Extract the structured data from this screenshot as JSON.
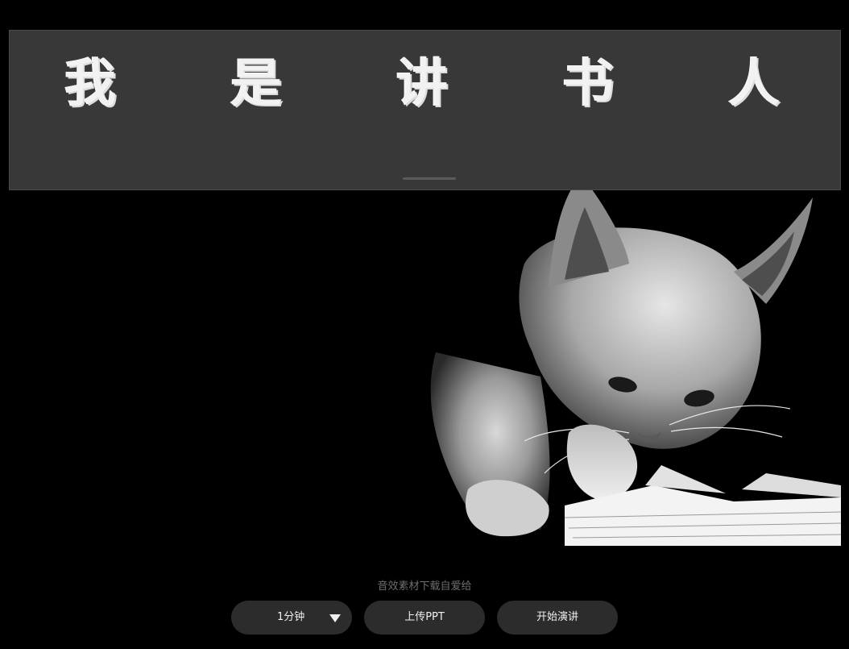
{
  "slide": {
    "title_chars": [
      "我",
      "是",
      "讲",
      "书",
      "人"
    ]
  },
  "credit_text": "音效素材下载自爱给",
  "controls": {
    "duration": {
      "value": "1分钟",
      "icon": "triangle-down-icon"
    },
    "upload_label": "上传PPT",
    "start_label": "开始演讲"
  },
  "colors": {
    "background": "#000000",
    "title_band": "#383838",
    "button": "#2c2c2c",
    "button_text": "#f0f0f0",
    "credit_text": "#6e6e6e"
  }
}
